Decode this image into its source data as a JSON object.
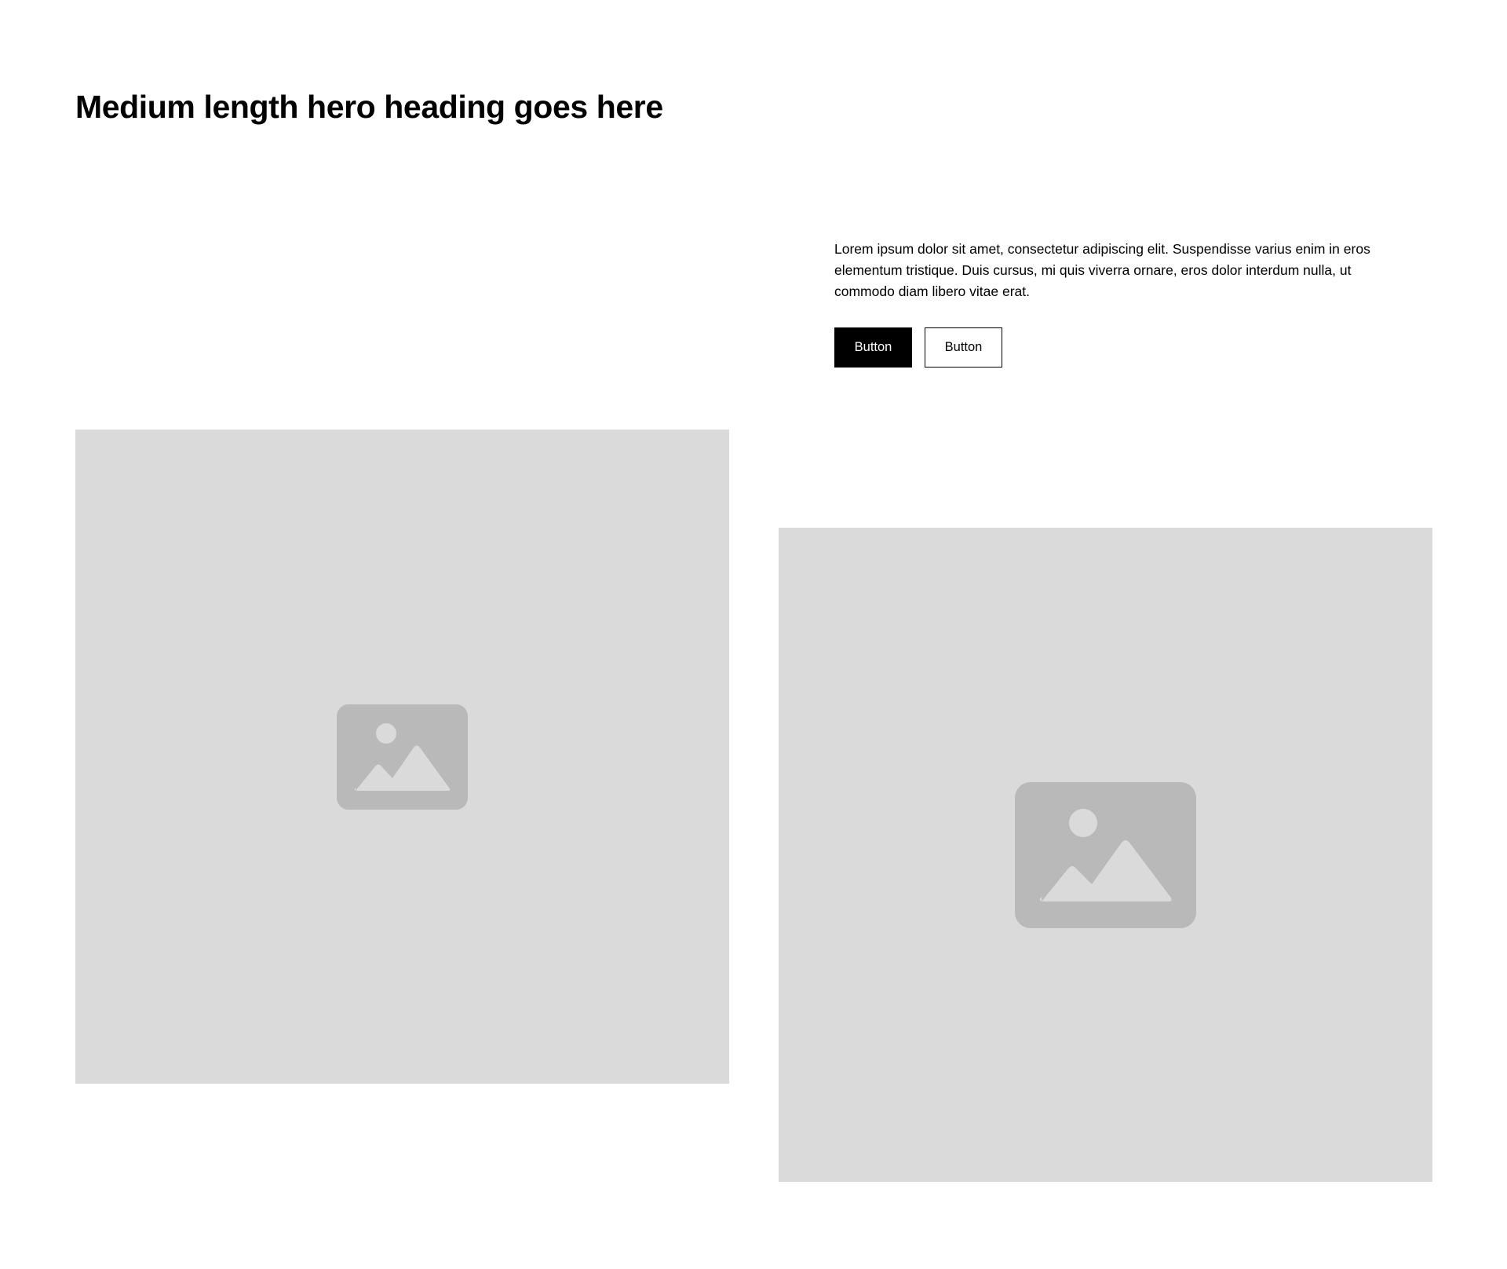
{
  "hero": {
    "heading": "Medium length hero heading goes here",
    "paragraph": "Lorem ipsum dolor sit amet, consectetur adipiscing elit. Suspendisse varius enim in eros elementum tristique. Duis cursus, mi quis viverra ornare, eros dolor interdum nulla, ut commodo diam libero vitae erat.",
    "primary_button_label": "Button",
    "secondary_button_label": "Button"
  },
  "images": [
    {
      "icon": "image-placeholder-icon"
    },
    {
      "icon": "image-placeholder-icon"
    }
  ],
  "colors": {
    "text": "#000000",
    "background": "#ffffff",
    "placeholder_fill": "#dadada",
    "placeholder_icon": "#b9b9b9",
    "primary_button_bg": "#000000",
    "primary_button_text": "#ffffff"
  }
}
